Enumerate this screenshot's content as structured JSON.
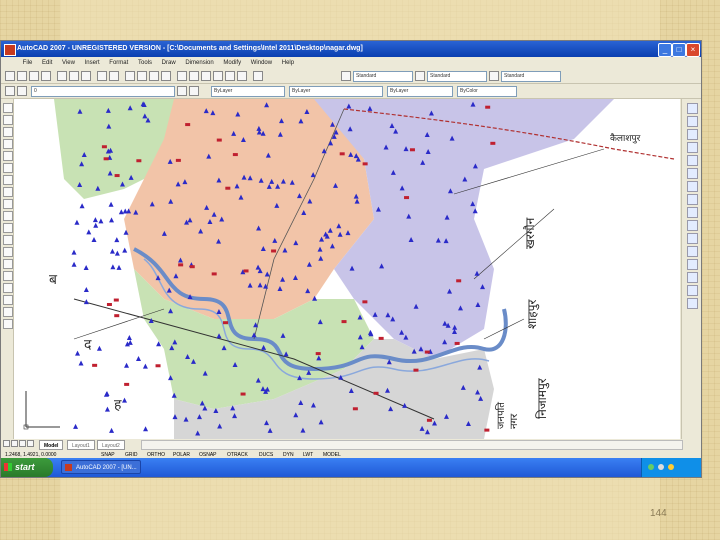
{
  "window": {
    "title": "AutoCAD 2007 - UNREGISTERED VERSION - [C:\\Documents and Settings\\Intel 2011\\Desktop\\nagar.dwg]"
  },
  "menubar": {
    "items": [
      "File",
      "Edit",
      "View",
      "Insert",
      "Format",
      "Tools",
      "Draw",
      "Dimension",
      "Modify",
      "Window",
      "Help"
    ]
  },
  "toolbar": {
    "text_style": "Standard",
    "dim_style": "Standard",
    "table_style": "Standard",
    "layer": "0",
    "color": "ByLayer",
    "linetype": "ByLayer",
    "lineweight": "ByLayer",
    "plot_style": "ByColor"
  },
  "layout_tabs": [
    "Model",
    "Layout1",
    "Layout2"
  ],
  "status": {
    "coords": "1.2468, 1.4921, 0.0000",
    "buttons": [
      "SNAP",
      "GRID",
      "ORTHO",
      "POLAR",
      "OSNAP",
      "OTRACK",
      "DUCS",
      "DYN",
      "LWT",
      "MODEL"
    ]
  },
  "taskbar": {
    "start_label": "start",
    "task_label": "AutoCAD 2007 - [UN..."
  },
  "map_labels": {
    "v1": "कैलाशपुर",
    "v2": "खरगौन",
    "v3": "शाहपुर",
    "v4": "निजामपुर",
    "v5": "जनपति",
    "v6": "नगर",
    "l1": "ब",
    "l2": "द",
    "l3": "ह"
  },
  "slide": {
    "page_number": "144"
  },
  "colors": {
    "region_purple": "#c8c4e8",
    "region_orange": "#f2c4a8",
    "region_green": "#c8e2b4",
    "region_gray": "#d6d6d6",
    "river": "#6a8cc8",
    "markers": "#2a2ac8"
  }
}
